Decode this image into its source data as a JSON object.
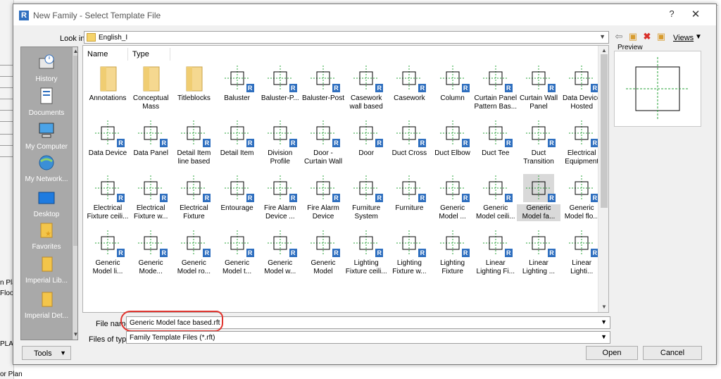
{
  "background": {
    "left_texts": [
      "n Plan",
      "Floo",
      "PLAN",
      "or Plan"
    ]
  },
  "dialog": {
    "title": "New Family - Select Template File",
    "help": "?",
    "close": "✕"
  },
  "look_in": {
    "label": "Look in:",
    "value": "English_I"
  },
  "toolbar": {
    "views_label": "Views"
  },
  "places": [
    {
      "label": "History",
      "icon": "history-icon"
    },
    {
      "label": "Documents",
      "icon": "documents-icon"
    },
    {
      "label": "My Computer",
      "icon": "my-computer-icon"
    },
    {
      "label": "My Network...",
      "icon": "my-network-icon"
    },
    {
      "label": "Desktop",
      "icon": "desktop-icon"
    },
    {
      "label": "Favorites",
      "icon": "favorites-icon"
    },
    {
      "label": "Imperial Lib...",
      "icon": "folder-icon"
    },
    {
      "label": "Imperial Det...",
      "icon": "folder-icon"
    }
  ],
  "file_list": {
    "columns": [
      "Name",
      "Type"
    ],
    "items": [
      [
        "Annotations",
        ""
      ],
      [
        "Conceptual",
        "Mass"
      ],
      [
        "Titleblocks",
        ""
      ],
      [
        "Baluster",
        ""
      ],
      [
        "Baluster-P...",
        ""
      ],
      [
        "Baluster-Post",
        ""
      ],
      [
        "Casework",
        "wall based"
      ],
      [
        "Casework",
        ""
      ],
      [
        "Column",
        ""
      ],
      [
        "Curtain Panel",
        "Pattern Bas..."
      ],
      [
        "Curtain Wall",
        "Panel"
      ],
      [
        "Data Device",
        "Hosted"
      ],
      [
        "Data Device",
        ""
      ],
      [
        "Data Panel",
        ""
      ],
      [
        "Detail Item",
        "line based"
      ],
      [
        "Detail Item",
        ""
      ],
      [
        "Division",
        "Profile"
      ],
      [
        "Door -",
        "Curtain Wall"
      ],
      [
        "Door",
        ""
      ],
      [
        "Duct Cross",
        ""
      ],
      [
        "Duct Elbow",
        ""
      ],
      [
        "Duct Tee",
        ""
      ],
      [
        "Duct",
        "Transition"
      ],
      [
        "Electrical",
        "Equipment"
      ],
      [
        "Electrical",
        "Fixture ceili..."
      ],
      [
        "Electrical",
        "Fixture w..."
      ],
      [
        "Electrical",
        "Fixture"
      ],
      [
        "Entourage",
        ""
      ],
      [
        "Fire Alarm",
        "Device ..."
      ],
      [
        "Fire Alarm",
        "Device"
      ],
      [
        "Furniture",
        "System"
      ],
      [
        "Furniture",
        ""
      ],
      [
        "Generic",
        "Model ..."
      ],
      [
        "Generic",
        "Model ceili..."
      ],
      [
        "Generic",
        "Model fa..."
      ],
      [
        "Generic",
        "Model flo..."
      ],
      [
        "Generic",
        "Model li..."
      ],
      [
        "Generic",
        "Mode..."
      ],
      [
        "Generic",
        "Model ro..."
      ],
      [
        "Generic",
        "Model t..."
      ],
      [
        "Generic",
        "Model w..."
      ],
      [
        "Generic",
        "Model"
      ],
      [
        "Lighting",
        "Fixture ceili..."
      ],
      [
        "Lighting",
        "Fixture w..."
      ],
      [
        "Lighting",
        "Fixture"
      ],
      [
        "Linear",
        "Lighting Fi..."
      ],
      [
        "Linear",
        "Lighting ..."
      ],
      [
        "Linear",
        "Lighti..."
      ]
    ],
    "selected_index": 34
  },
  "file_name": {
    "label": "File name:",
    "value": "Generic Model face based.rft"
  },
  "file_type": {
    "label": "Files of type:",
    "value": "Family Template Files  (*.rft)"
  },
  "buttons": {
    "tools": "Tools",
    "open": "Open",
    "cancel": "Cancel"
  },
  "preview": {
    "label": "Preview"
  },
  "colors": {
    "revit_blue": "#2f6fbf",
    "annotation_red": "#e0342e",
    "places_gray": "#a9a9a9"
  }
}
